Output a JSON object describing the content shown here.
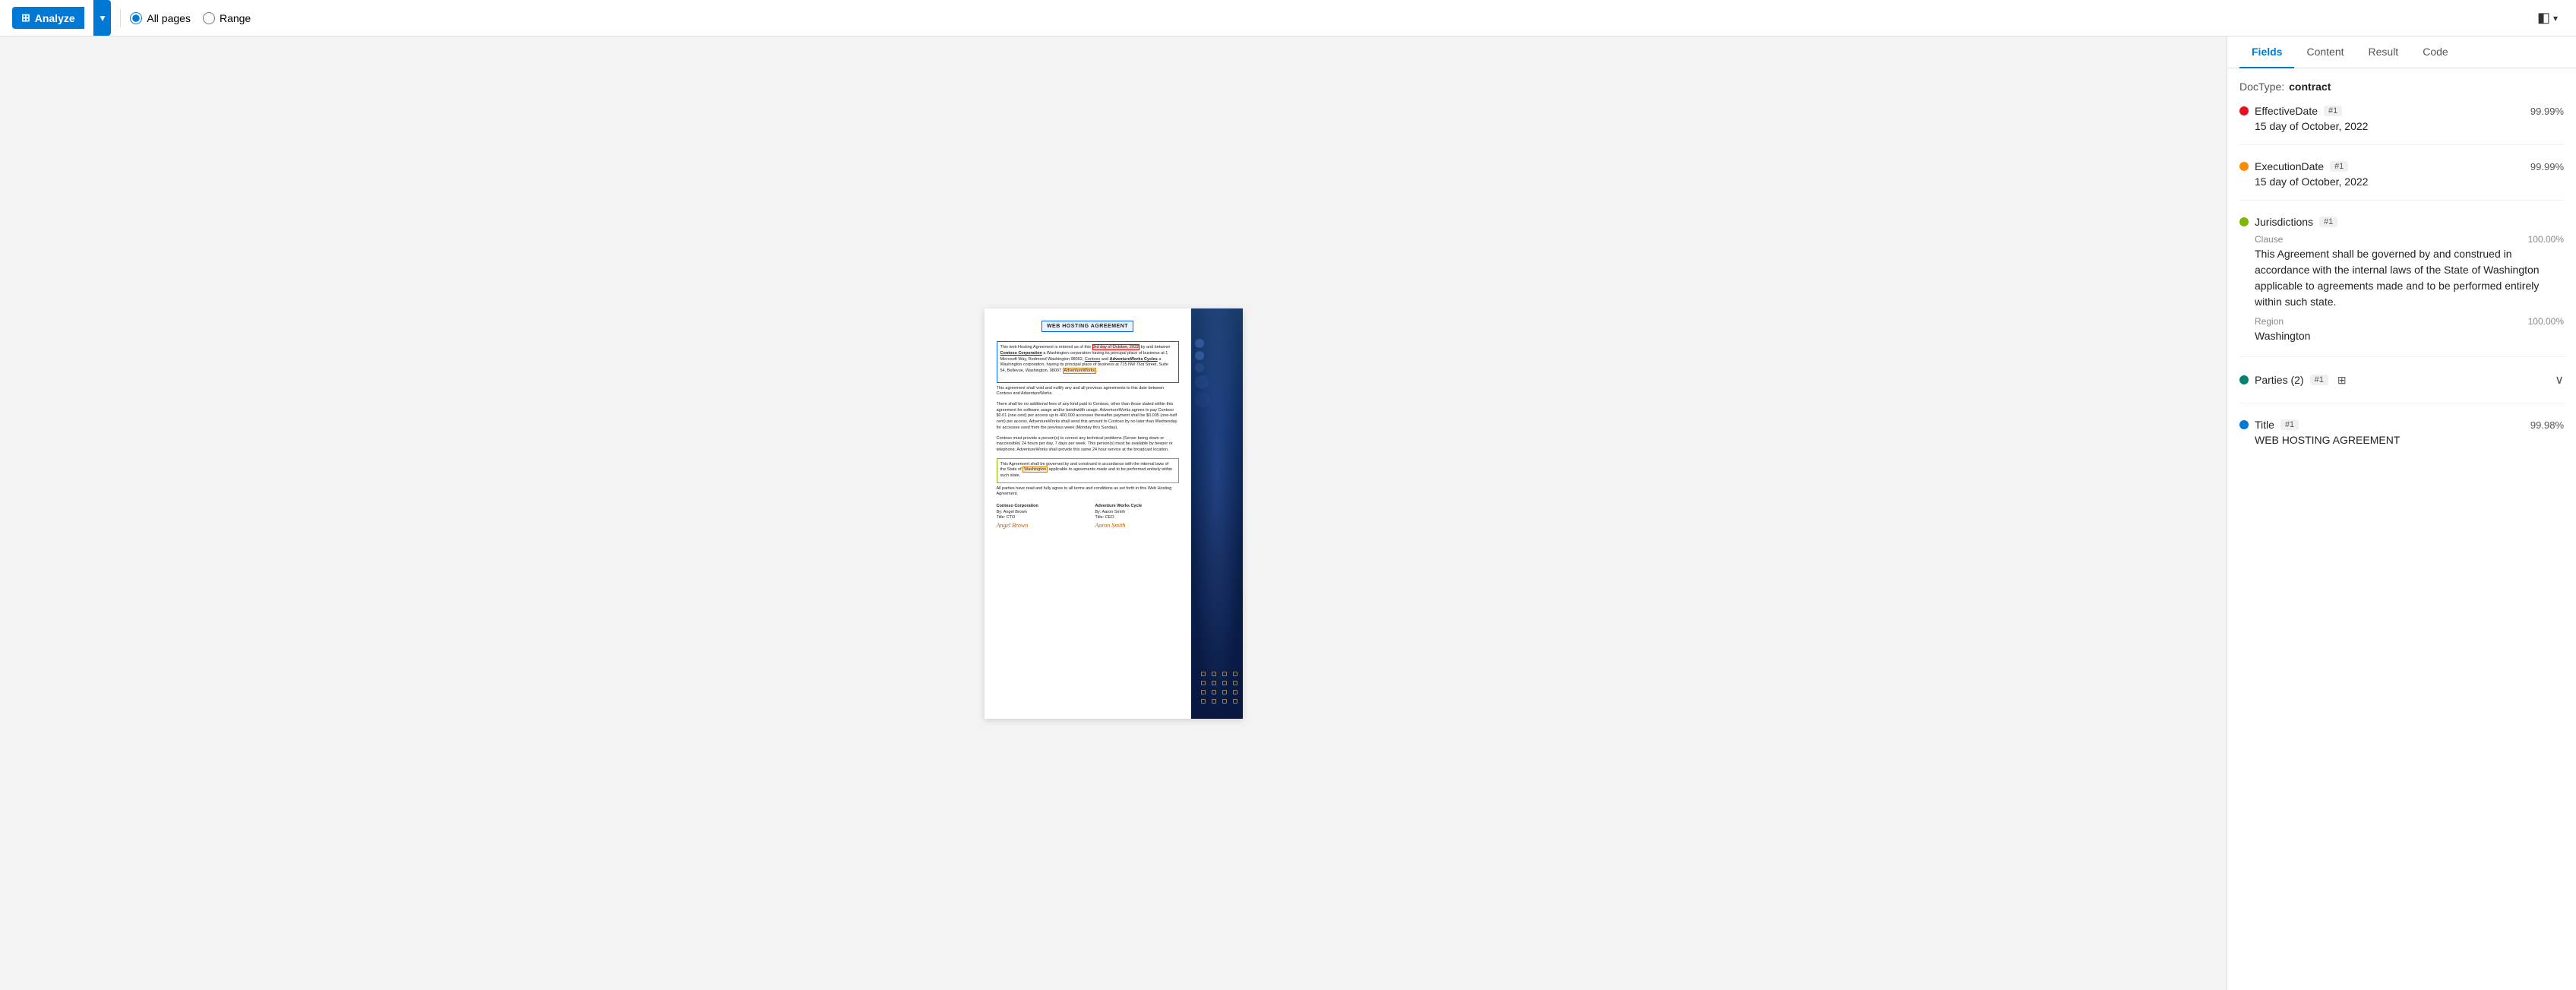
{
  "toolbar": {
    "analyze_label": "Analyze",
    "all_pages_label": "All pages",
    "range_label": "Range"
  },
  "tabs": {
    "items": [
      "Fields",
      "Content",
      "Result",
      "Code"
    ],
    "active": "Fields"
  },
  "panel": {
    "doctype_label": "DocType:",
    "doctype_value": "contract",
    "fields": [
      {
        "id": "effective-date",
        "name": "EffectiveDate",
        "dot_color": "red",
        "tag": "#1",
        "confidence": "99.99%",
        "value": "15 day of October, 2022",
        "sub_fields": []
      },
      {
        "id": "execution-date",
        "name": "ExecutionDate",
        "dot_color": "orange",
        "tag": "#1",
        "confidence": "99.99%",
        "value": "15 day of October, 2022",
        "sub_fields": []
      },
      {
        "id": "jurisdictions",
        "name": "Jurisdictions",
        "dot_color": "green",
        "tag": "#1",
        "confidence": "",
        "value": "",
        "sub_fields": [
          {
            "label": "Clause",
            "confidence": "100.00%",
            "value": "This Agreement shall be governed by and construed in accordance with the internal laws of the State of Washington applicable to agreements made and to be performed entirely within such state."
          },
          {
            "label": "Region",
            "confidence": "100.00%",
            "value": "Washington"
          }
        ]
      },
      {
        "id": "parties",
        "name": "Parties (2)",
        "dot_color": "teal",
        "tag": "#1",
        "confidence": "",
        "value": "",
        "has_table": true,
        "has_expand": true,
        "sub_fields": []
      },
      {
        "id": "title",
        "name": "Title",
        "dot_color": "blue",
        "tag": "#1",
        "confidence": "99.98%",
        "value": "WEB HOSTING AGREEMENT",
        "sub_fields": []
      }
    ]
  },
  "document": {
    "title": "WEB HOSTING AGREEMENT",
    "intro": "This web Hosting Agreement is entered as of this 3rd day of October, 2022 by and between Contoso Corporation a Washington corporation having its principal place of business at 1 Microsoft Way, Redmond Washington 98052, Contoso and AdventureWorks Cycles a Washington corporation, having its principal place of business at 715 NW 76st Street, Suite 54, Bellevue, Washington, 98007 AdventureWorks.",
    "p2": "This agreement shall void and nullify any and all previous agreements to this date between Contoso and AdventureWorks.",
    "p3": "There shall be no additional fees of any kind paid to Contoso, other than those stated within this agreement for software usage and/or bandwidth usage. AdventureWorks agrees to pay Contoso $0.01 (one cent) per access up to 400,000 accesses thereafter payment shall be $0.005 (one-half cent) per access. AdventureWorks shall send this amount to Contoso by no later than Wednesday for accesses used from the previous week (Monday thru Sunday).",
    "p4": "Contoso must provide a person(s) to correct any technical problems (Server being down or inaccessible) 24 hours per day, 7 days per week. This person(s) must be available by beeper or telephone. AdventureWorks shall provide this same 24 hour service at the broadcast location.",
    "jurisdiction_text": "This Agreement shall be governed by and construed in accordance with the internal laws of the State of Washington applicable to agreements made and to be performed entirely within such state.",
    "p_final": "All parties have read and fully agree to all terms and conditions as set forth in this Web Hosting Agreement.",
    "party1_name": "Contoso Corporation",
    "party1_by": "By: Angel Brown",
    "party1_title": "Title: CTO",
    "party1_sig": "Angel Brown",
    "party2_name": "Adventure Works Cycle",
    "party2_by": "By: Aaron Smith",
    "party2_title": "Title: CEO",
    "party2_sig": "Aaron Smith"
  }
}
